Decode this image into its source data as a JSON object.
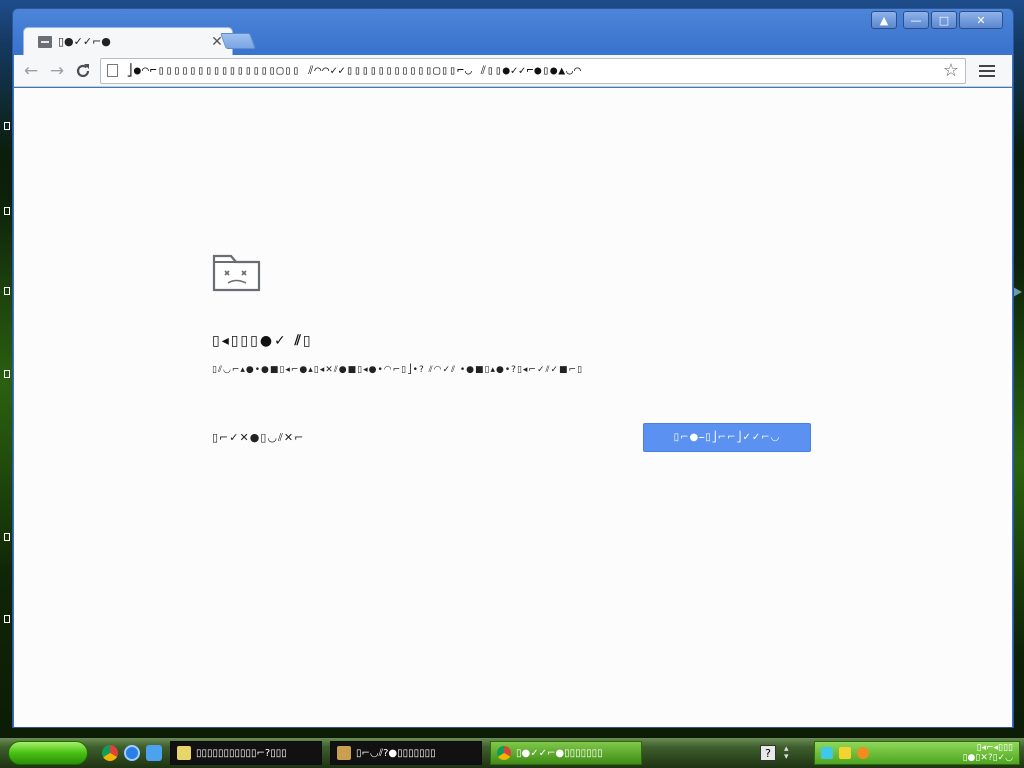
{
  "window": {
    "controls": {
      "profile": "▲",
      "minimize": "—",
      "maximize": "□",
      "close": "✕"
    }
  },
  "tab": {
    "title": "▯●✓✓⌐●",
    "close": "✕"
  },
  "toolbar": {
    "back": "←",
    "forward": "→",
    "reload": "C",
    "url": "⎦●◠⌐▯▯▯▯▯▯▯▯▯▯▯▯▯▯▯▢▯▯ ⫽◠◠✓✓▯▯▯▯▯▯▯▯▯▯▯▢▯▯⌐◡ ⫽▯▯●✓✓⌐●▯●▲◡◠",
    "bookmark_star": "☆"
  },
  "error_page": {
    "heading": "▯◂▯▯▯●✓ ⫽▯",
    "detail": "▯⫽◡⌐▴●•●■▯◂⌐●▴▯◂✕⫽●■▯◂●•◠⌐▯⎦•? ⫽◠✓⫽ •●■▯▴●•?▯◂⌐✓⫽✓■⌐▯",
    "more_link": "▯⌐✓✕●▯◡⫽✕⌐",
    "reload_button": "▯⌐●⎯▯⎦⌐⌐⎦✓✓⌐◡"
  },
  "taskbar": {
    "tasks": [
      {
        "label": "▯▯▯▯▯▯▯▯▯▯▯⌐?▯▯▯"
      },
      {
        "label": "▯⌐◡⫽?●▯▯▯▯▯▯▯"
      },
      {
        "label": "▯●✓✓⌐●▯▯▯▯▯▯▯"
      }
    ],
    "help": "?",
    "clock_line1": "▯◂⌐◂▯▯▯",
    "clock_line2": "▯●▯✕?▯✓◡"
  },
  "colors": {
    "reload_button": "#5b91f1",
    "window_frame": "#3a6fc7",
    "content_bg": "#fcfcfd"
  },
  "icons": {
    "error_icon": "sad-folder-icon",
    "tab_favicon": "sad-page-icon"
  }
}
